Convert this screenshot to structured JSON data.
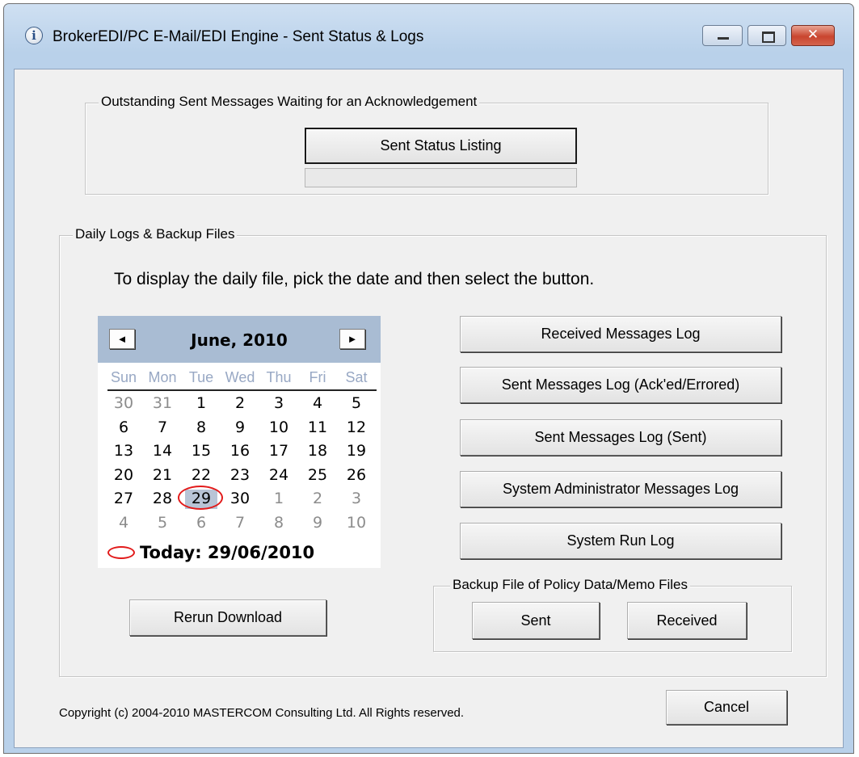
{
  "window": {
    "title": "BrokerEDI/PC E-Mail/EDI Engine - Sent Status  & Logs",
    "icon": "info-icon",
    "controls": {
      "minimize": "minimize-icon",
      "maximize": "maximize-icon",
      "close": "✕"
    }
  },
  "outstanding": {
    "legend": "Outstanding Sent Messages Waiting for an Acknowledgement",
    "button": "Sent Status Listing",
    "progress": 0
  },
  "daily": {
    "legend": "Daily Logs & Backup Files",
    "instruction": "To display the daily file, pick the date and then select the button."
  },
  "calendar": {
    "prev": "◄",
    "next": "►",
    "month": "June, 2010",
    "weekdays": [
      "Sun",
      "Mon",
      "Tue",
      "Wed",
      "Thu",
      "Fri",
      "Sat"
    ],
    "days": [
      [
        "30",
        "31",
        "1",
        "2",
        "3",
        "4",
        "5"
      ],
      [
        "6",
        "7",
        "8",
        "9",
        "10",
        "11",
        "12"
      ],
      [
        "13",
        "14",
        "15",
        "16",
        "17",
        "18",
        "19"
      ],
      [
        "20",
        "21",
        "22",
        "23",
        "24",
        "25",
        "26"
      ],
      [
        "27",
        "28",
        "29",
        "30",
        "1",
        "2",
        "3"
      ],
      [
        "4",
        "5",
        "6",
        "7",
        "8",
        "9",
        "10"
      ]
    ],
    "selected": "29",
    "today_label": "Today: 29/06/2010"
  },
  "logs": {
    "received": "Received Messages Log",
    "sent_acked": "Sent Messages Log (Ack'ed/Errored)",
    "sent": "Sent Messages Log (Sent)",
    "sysadmin": "System Administrator Messages Log",
    "run": "System Run Log"
  },
  "backup": {
    "legend": "Backup File of Policy Data/Memo Files",
    "sent": "Sent",
    "received": "Received"
  },
  "rerun_button": "Rerun Download",
  "footer": {
    "copyright": "Copyright (c) 2004-2010 MASTERCOM Consulting Ltd. All Rights reserved.",
    "cancel": "Cancel"
  }
}
